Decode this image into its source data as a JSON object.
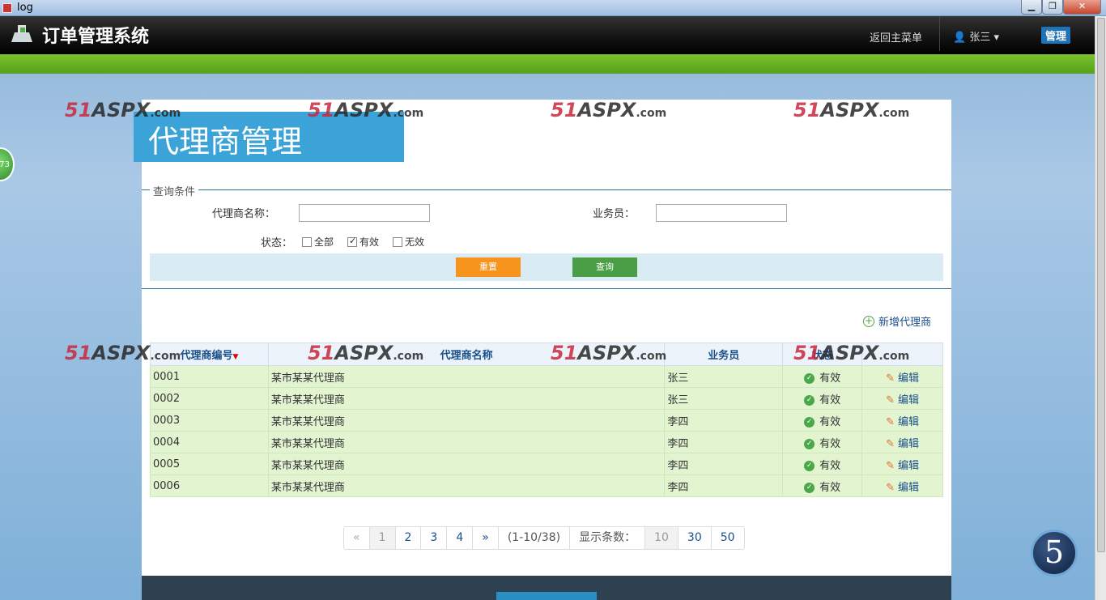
{
  "window": {
    "title": "log"
  },
  "header": {
    "app_title": "订单管理系统",
    "back_link": "返回主菜单",
    "user_name": "张三",
    "admin_label": "管理"
  },
  "side_badge": "73",
  "page": {
    "title": "代理商管理"
  },
  "criteria": {
    "legend": "查询条件",
    "agent_name_label": "代理商名称：",
    "agent_name_value": "",
    "salesperson_label": "业务员：",
    "salesperson_value": "",
    "status_label": "状态：",
    "status_options": [
      {
        "label": "全部",
        "checked": false
      },
      {
        "label": "有效",
        "checked": true
      },
      {
        "label": "无效",
        "checked": false
      }
    ],
    "reset_button": "重置",
    "search_button": "查询"
  },
  "add_agent_link": "新增代理商",
  "table": {
    "headers": [
      "代理商编号",
      "代理商名称",
      "业务员",
      "状态",
      ""
    ],
    "rows": [
      {
        "code": "0001",
        "name": "某市某某代理商",
        "salesperson": "张三",
        "status": "有效",
        "action": "编辑"
      },
      {
        "code": "0002",
        "name": "某市某某代理商",
        "salesperson": "张三",
        "status": "有效",
        "action": "编辑"
      },
      {
        "code": "0003",
        "name": "某市某某代理商",
        "salesperson": "李四",
        "status": "有效",
        "action": "编辑"
      },
      {
        "code": "0004",
        "name": "某市某某代理商",
        "salesperson": "李四",
        "status": "有效",
        "action": "编辑"
      },
      {
        "code": "0005",
        "name": "某市某某代理商",
        "salesperson": "李四",
        "status": "有效",
        "action": "编辑"
      },
      {
        "code": "0006",
        "name": "某市某某代理商",
        "salesperson": "李四",
        "status": "有效",
        "action": "编辑"
      }
    ]
  },
  "pagination": {
    "prev": "«",
    "pages": [
      "1",
      "2",
      "3",
      "4"
    ],
    "current_page": "1",
    "next": "»",
    "range_info": "(1-10/38)",
    "page_size_label": "显示条数：",
    "page_sizes": [
      "10",
      "30",
      "50"
    ],
    "current_page_size": "10"
  },
  "watermark": {
    "main": "51",
    "aspx": "ASPX",
    "suffix": ".com"
  },
  "floating_badge": "5",
  "colors": {
    "header_bg": "#111111",
    "green_bar": "#6cb627",
    "title_blue": "#3ba3d7",
    "reset_orange": "#f7941d",
    "search_green": "#4a9e45",
    "row_green": "#e2f4d0",
    "link_blue": "#1a4f8a"
  }
}
